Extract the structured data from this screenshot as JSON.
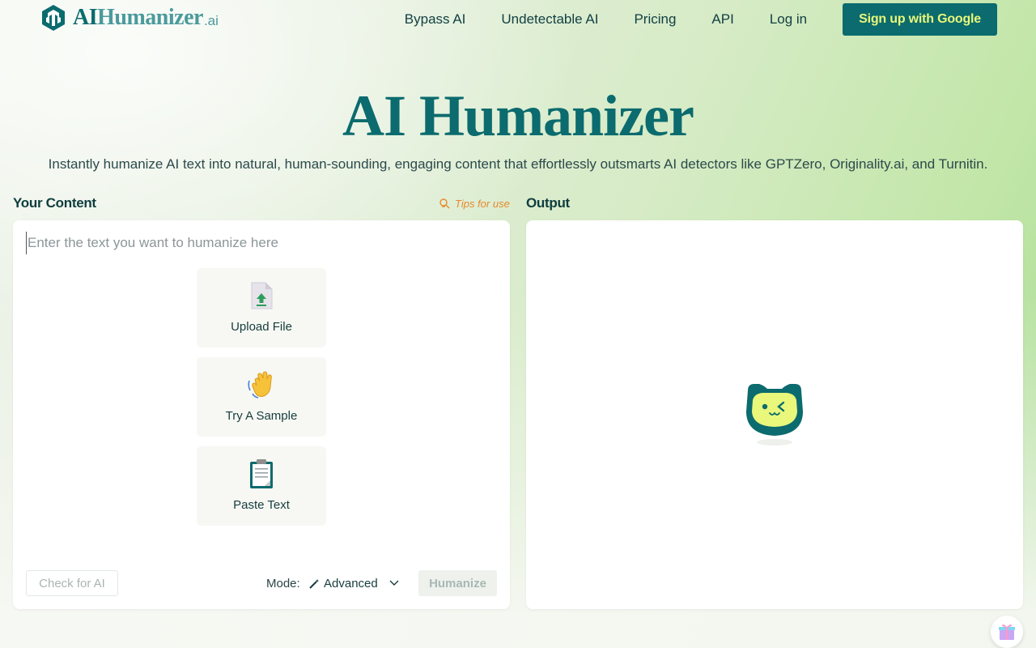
{
  "brand": {
    "name_strong": "AI",
    "name_light": "Humanizer",
    "suffix": ".ai",
    "color": "#0b6b6e",
    "accent": "#e9f77a"
  },
  "nav": {
    "links": [
      "Bypass AI",
      "Undetectable AI",
      "Pricing",
      "API",
      "Log in"
    ],
    "signup_label": "Sign up with Google"
  },
  "hero": {
    "title": "AI Humanizer",
    "subtitle": "Instantly humanize AI text into natural, human-sounding, engaging content that effortlessly outsmarts AI detectors like GPTZero, Originality.ai, and Turnitin."
  },
  "input_panel": {
    "label": "Your Content",
    "tips_label": "Tips for use",
    "placeholder": "Enter the text you want to humanize here",
    "actions": [
      {
        "label": "Upload File",
        "icon": "upload-file-icon"
      },
      {
        "label": "Try A Sample",
        "icon": "waving-hand-icon"
      },
      {
        "label": "Paste Text",
        "icon": "clipboard-icon"
      }
    ],
    "check_label": "Check for AI",
    "mode_label": "Mode:",
    "mode_value": "Advanced",
    "humanize_label": "Humanize"
  },
  "output_panel": {
    "label": "Output",
    "mascot_icon": "winking-mascot-icon"
  },
  "floating": {
    "icon": "gift-icon"
  }
}
